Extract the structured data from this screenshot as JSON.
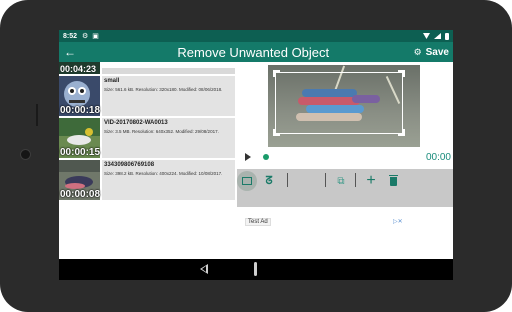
{
  "status_bar": {
    "time": "8:52",
    "icons": [
      "gear-icon",
      "save-card-icon"
    ],
    "right_icons": [
      "wifi-icon",
      "signal-icon",
      "battery-icon"
    ]
  },
  "app_bar": {
    "title": "Remove Unwanted Object",
    "save_label": "Save",
    "back_icon": "arrow-left-icon",
    "settings_icon": "gear-icon"
  },
  "videos": [
    {
      "duration": "00:04:23"
    },
    {
      "duration": "00:00:18",
      "name": "small",
      "meta": "Size: 561.6 kB. Resolution: 320x180. Modified: 08/06/2018."
    },
    {
      "duration": "00:00:15",
      "name": "VID-20170802-WA0013",
      "meta": "Size: 3.5 MB. Resolution: 640x352. Modified: 29/08/2017."
    },
    {
      "duration": "00:00:08",
      "name": "334309806769108",
      "meta": "Size: 398.2 kB. Resolution: 400x224. Modified: 10/08/2017."
    }
  ],
  "player": {
    "time": "00:00"
  },
  "toolbar": {
    "tools": [
      "rectangle-select-icon",
      "lasso-select-icon",
      "layers-icon",
      "add-icon",
      "delete-icon"
    ]
  },
  "ad": {
    "label": "Test Ad"
  },
  "colors": {
    "primary": "#147a69",
    "status_bar": "#0d5f52",
    "accent": "#1a9b6a",
    "toolbar": "#c8c8c8"
  }
}
